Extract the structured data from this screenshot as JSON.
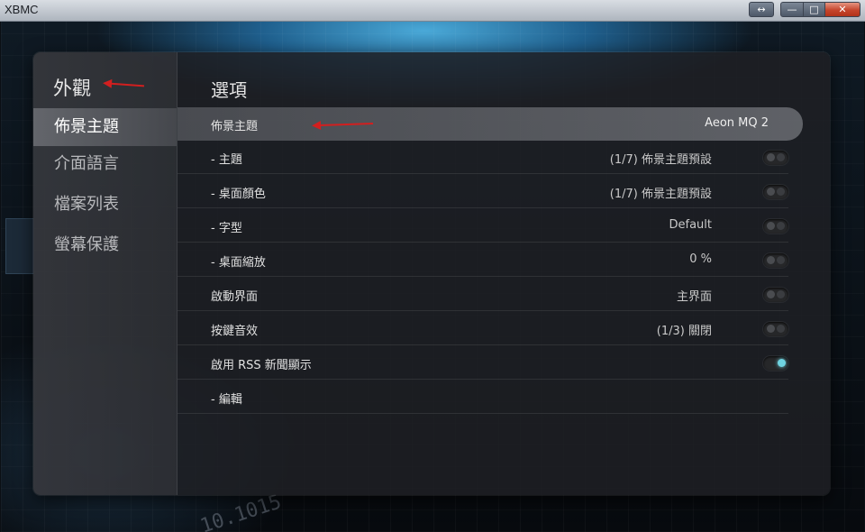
{
  "window": {
    "title": "XBMC",
    "buttons": {
      "resize": "↔",
      "minimize": "—",
      "maximize": "□",
      "close": "✕"
    }
  },
  "background": {
    "number_text": "10.1015"
  },
  "sidebar": {
    "heading": "外觀",
    "items": [
      {
        "label": "佈景主題",
        "active": true
      },
      {
        "label": "介面語言",
        "active": false
      },
      {
        "label": "檔案列表",
        "active": false
      },
      {
        "label": "螢幕保護",
        "active": false
      }
    ]
  },
  "content": {
    "title": "選項",
    "rows": [
      {
        "label": "佈景主題",
        "value": "Aeon MQ 2",
        "toggle": "none",
        "highlight": true
      },
      {
        "label": "- 主題",
        "value": "(1/7) 佈景主題預設",
        "toggle": "off"
      },
      {
        "label": "- 桌面顏色",
        "value": "(1/7) 佈景主題預設",
        "toggle": "off"
      },
      {
        "label": "- 字型",
        "value": "Default",
        "toggle": "off"
      },
      {
        "label": "- 桌面縮放",
        "value": "0 %",
        "toggle": "off"
      },
      {
        "label": "啟動界面",
        "value": "主界面",
        "toggle": "off"
      },
      {
        "label": "按鍵音效",
        "value": "(1/3) 關閉",
        "toggle": "off"
      },
      {
        "label": "啟用 RSS 新聞顯示",
        "value": "",
        "toggle": "on"
      },
      {
        "label": "- 編輯",
        "value": "",
        "toggle": "none"
      }
    ]
  },
  "colors": {
    "accent": "#6fd3e0",
    "annotation_arrow": "#d21f1f"
  }
}
